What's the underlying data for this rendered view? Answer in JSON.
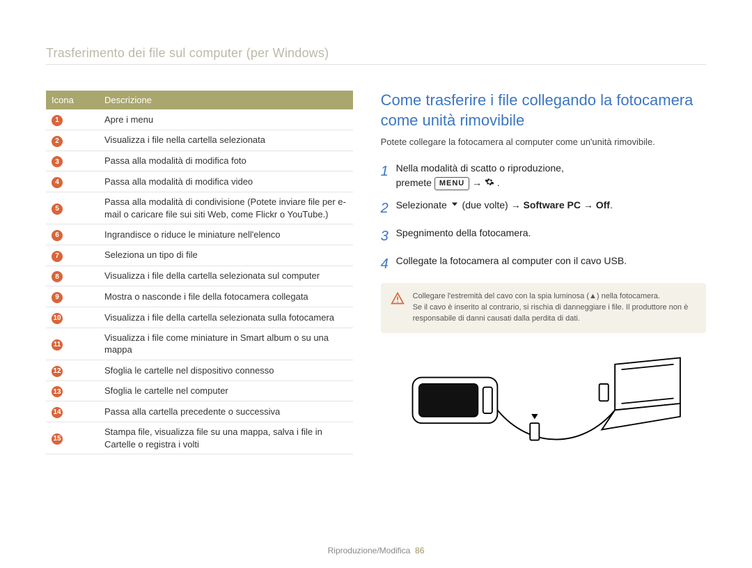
{
  "page_title": "Trasferimento dei file sul computer (per Windows)",
  "table": {
    "head_icon": "Icona",
    "head_desc": "Descrizione",
    "rows": [
      {
        "n": "1",
        "desc": "Apre i menu"
      },
      {
        "n": "2",
        "desc": "Visualizza i file nella cartella selezionata"
      },
      {
        "n": "3",
        "desc": "Passa alla modalità di modifica foto"
      },
      {
        "n": "4",
        "desc": "Passa alla modalità di modifica video"
      },
      {
        "n": "5",
        "desc": "Passa alla modalità di condivisione (Potete inviare file per e-mail o caricare file sui siti Web, come Flickr o YouTube.)"
      },
      {
        "n": "6",
        "desc": "Ingrandisce o riduce le miniature nell'elenco"
      },
      {
        "n": "7",
        "desc": "Seleziona un tipo di file"
      },
      {
        "n": "8",
        "desc": "Visualizza i file della cartella selezionata sul computer"
      },
      {
        "n": "9",
        "desc": "Mostra o nasconde i file della fotocamera collegata"
      },
      {
        "n": "10",
        "desc": "Visualizza i file della cartella selezionata sulla fotocamera"
      },
      {
        "n": "11",
        "desc": "Visualizza i file come miniature in Smart album o su una mappa"
      },
      {
        "n": "12",
        "desc": "Sfoglia le cartelle nel dispositivo connesso"
      },
      {
        "n": "13",
        "desc": "Sfoglia le cartelle nel computer"
      },
      {
        "n": "14",
        "desc": "Passa alla cartella precedente o successiva"
      },
      {
        "n": "15",
        "desc": "Stampa file, visualizza file su una mappa, salva i file in Cartelle o registra i volti"
      }
    ]
  },
  "section": {
    "heading": "Come trasferire i file collegando la fotocamera come unità rimovibile",
    "intro": "Potete collegare la fotocamera al computer come un'unità rimovibile.",
    "steps": {
      "s1a": "Nella modalità di scatto o riproduzione,",
      "s1b_pre": "premete ",
      "s1_menu": "MENU",
      "s1_arrow": " → ",
      "s2_pre": "Selezionate ",
      "s2_mid": " (due volte) → ",
      "s2_bold": "Software PC",
      "s2_arrow": " → ",
      "s2_off": "Off",
      "s2_period": ".",
      "s3": "Spegnimento della fotocamera.",
      "s4": "Collegate la fotocamera al computer con il cavo USB."
    },
    "note_line1": "Collegare l'estremità del cavo con la spia luminosa (▲) nella fotocamera.",
    "note_line2": "Se il cavo è inserito al contrario, si rischia di danneggiare i file. Il produttore non è responsabile di danni causati dalla perdita di dati."
  },
  "footer": {
    "section": "Riproduzione/Modifica",
    "page": "86"
  }
}
